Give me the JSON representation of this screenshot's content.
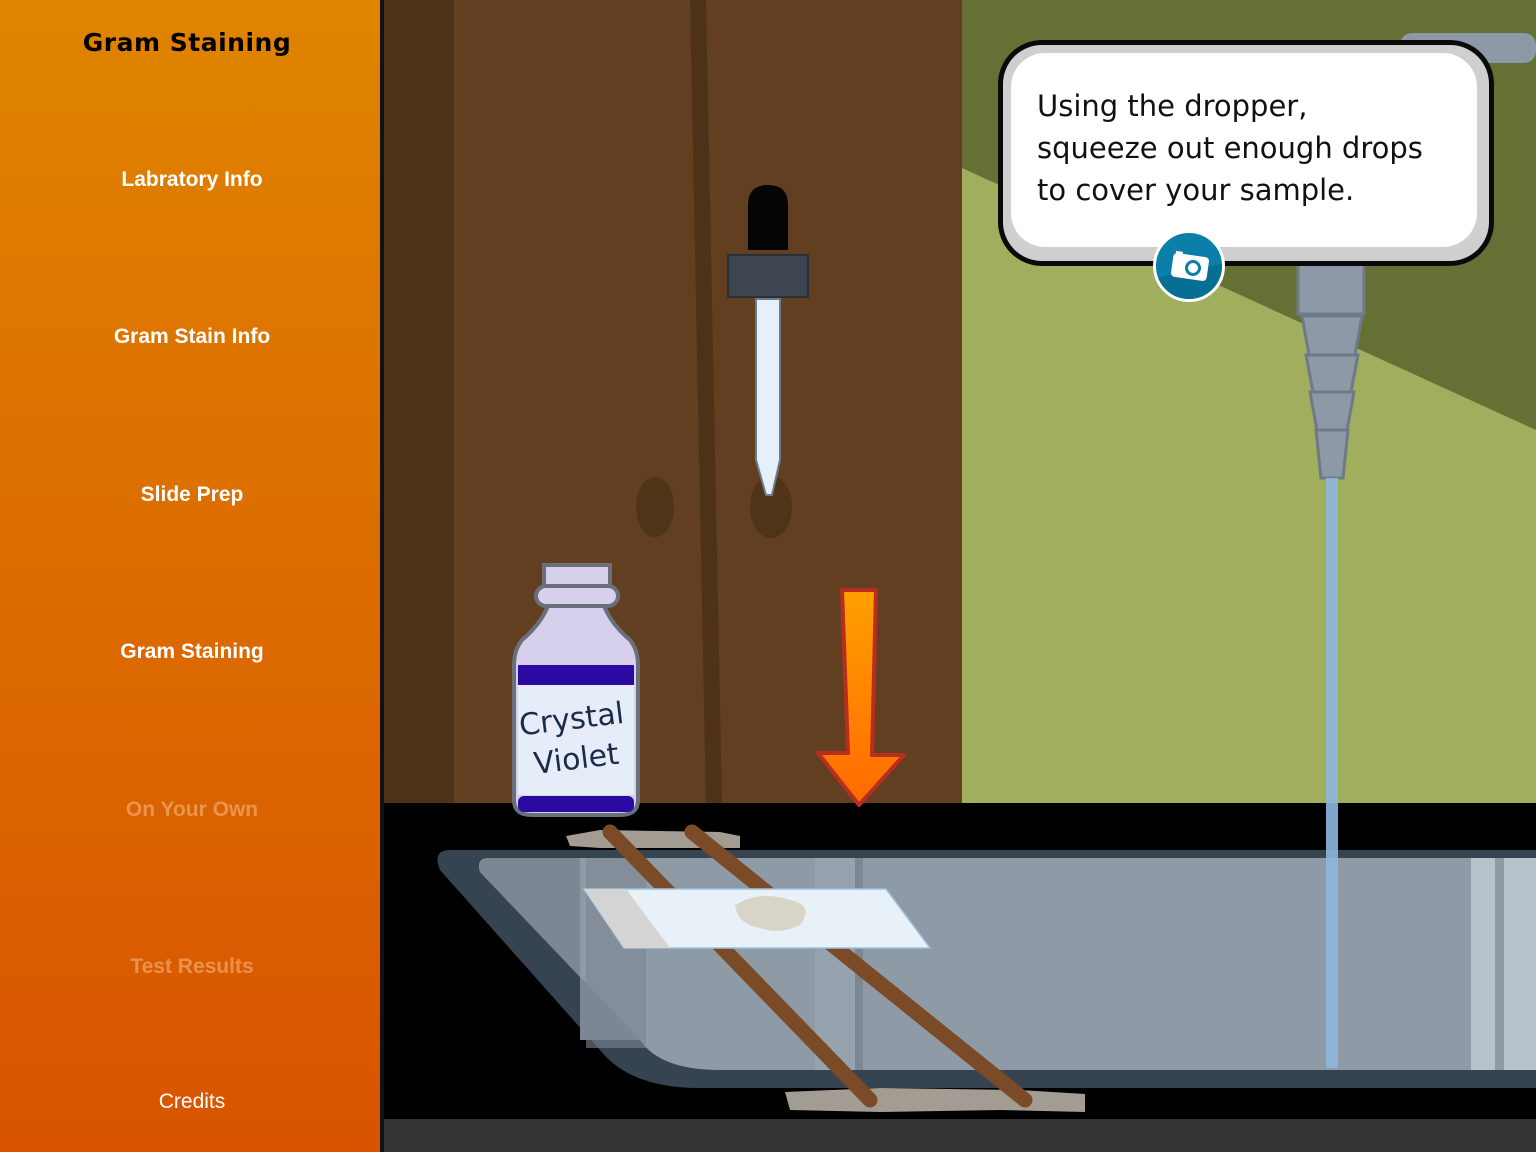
{
  "sidebar": {
    "title": "Gram Staining",
    "items": [
      {
        "label": "Labratory Info",
        "state": "enabled"
      },
      {
        "label": "Gram Stain Info",
        "state": "enabled"
      },
      {
        "label": "Slide Prep",
        "state": "enabled"
      },
      {
        "label": "Gram Staining",
        "state": "enabled"
      },
      {
        "label": "On Your Own",
        "state": "disabled"
      },
      {
        "label": "Test Results",
        "state": "disabled"
      },
      {
        "label": "Credits",
        "state": "enabled"
      }
    ]
  },
  "scene": {
    "instruction": "Using the dropper,\nsqueeze out enough drops\nto cover your sample.",
    "bottle_label": "Crystal\nViolet",
    "camera_icon": "camera-icon",
    "arrow_icon": "down-arrow-icon"
  },
  "colors": {
    "sidebar_top": "#df8400",
    "sidebar_bottom": "#d85400",
    "wall_brown": "#613f20",
    "wall_green_dark": "#657035",
    "wall_green_light": "#a1ae5e",
    "sink_basin": "#8e9aa6",
    "crystal_violet": "#2a0aa0",
    "arrow_orange": "#ff8a00",
    "camera_blue": "#0a7fa9"
  }
}
